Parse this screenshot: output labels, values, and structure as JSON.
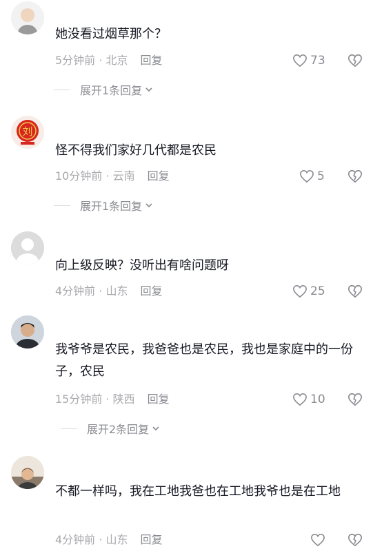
{
  "comments": [
    {
      "text": "她没看过烟草那个？",
      "time_location": "5分钟前 · 北京",
      "reply": "回复",
      "likes": "73",
      "expand": "展开1条回复"
    },
    {
      "text": "怪不得我们家好几代都是农民",
      "time_location": "10分钟前 · 云南",
      "reply": "回复",
      "likes": "5",
      "expand": "展开1条回复",
      "avatar_glyph": "刘"
    },
    {
      "text": "向上级反映？没听出有啥问题呀",
      "time_location": "4分钟前 · 山东",
      "reply": "回复",
      "likes": "25"
    },
    {
      "text": "我爷爷是农民，我爸爸也是农民，我也是家庭中的一份子，农民",
      "time_location": "15分钟前 · 陕西",
      "reply": "回复",
      "likes": "10",
      "expand": "展开2条回复"
    },
    {
      "text": "不都一样吗，我在工地我爸也在工地我爷也是在工地",
      "time_location": "4分钟前 · 山东",
      "reply": "回复",
      "likes": ""
    }
  ],
  "icons": {
    "like": "heart-outline-icon",
    "dislike": "broken-heart-icon",
    "expand": "chevron-down-icon"
  },
  "colors": {
    "text": "#161823",
    "meta": "#a8a8ac",
    "secondary": "#8a8b91",
    "avatar_red": "#d7261e"
  }
}
